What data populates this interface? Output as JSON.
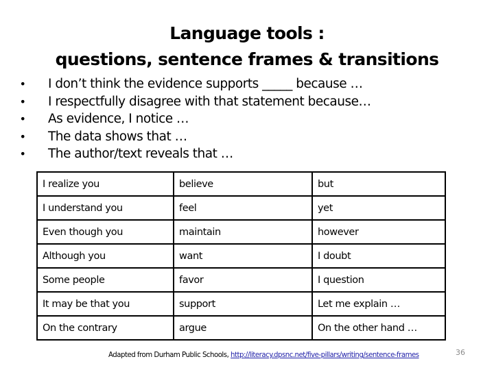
{
  "slide": {
    "title_line1": "Language tools :",
    "title_line2": "questions, sentence frames & transitions",
    "bullet_glyph": "•",
    "bullets": [
      "I don’t think the evidence supports _____ because …",
      "I respectfully disagree with that statement because…",
      "As evidence, I notice …",
      "The data shows that …",
      "The author/text reveals that …"
    ],
    "table": {
      "rows": [
        [
          "I realize you",
          "believe",
          "but"
        ],
        [
          "I understand you",
          "feel",
          "yet"
        ],
        [
          "Even though you",
          "maintain",
          "however"
        ],
        [
          "Although you",
          "want",
          "I doubt"
        ],
        [
          "Some people",
          "favor",
          "I question"
        ],
        [
          "It may be that you",
          "support",
          "Let me explain …"
        ],
        [
          "On the contrary",
          "argue",
          "On the other hand …"
        ]
      ]
    },
    "footer": {
      "prefix": "Adapted from Durham Public Schools, ",
      "link_text": "http://literacy.dpsnc.net/five-pillars/writing/sentence-frames"
    },
    "page_number": "36",
    "colors": {
      "link": "#1f1fa8",
      "page_number": "#8a8a8a"
    }
  }
}
